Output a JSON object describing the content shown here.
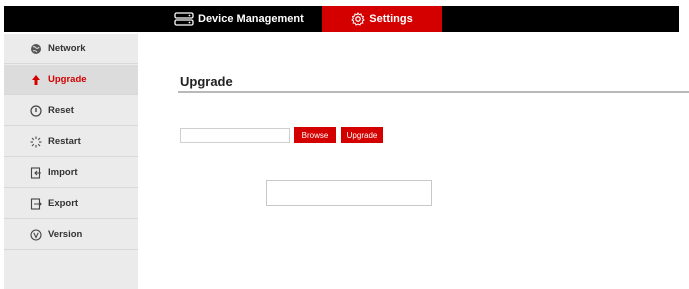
{
  "header": {
    "device_management_label": "Device Management",
    "settings_label": "Settings",
    "active_tab": "settings",
    "accent_color": "#d40000"
  },
  "sidebar": {
    "items": [
      {
        "label": "Network",
        "icon": "globe-icon"
      },
      {
        "label": "Upgrade",
        "icon": "arrow-up-icon",
        "active": true
      },
      {
        "label": "Reset",
        "icon": "power-icon"
      },
      {
        "label": "Restart",
        "icon": "spinner-icon"
      },
      {
        "label": "Import",
        "icon": "import-icon"
      },
      {
        "label": "Export",
        "icon": "export-icon"
      },
      {
        "label": "Version",
        "icon": "version-icon"
      }
    ]
  },
  "main": {
    "title": "Upgrade",
    "file_input_value": "",
    "browse_label": "Browse",
    "upgrade_label": "Upgrade",
    "status_text": ""
  }
}
